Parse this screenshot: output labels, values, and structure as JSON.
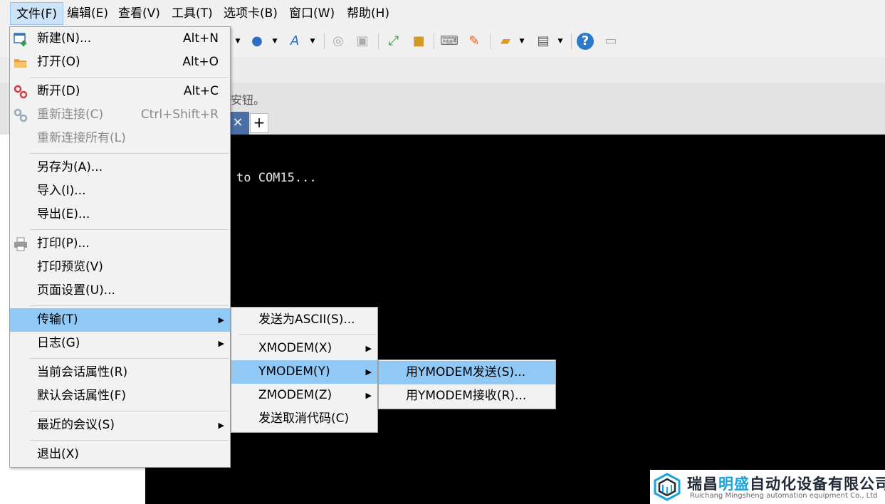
{
  "menubar": [
    "文件(F)",
    "编辑(E)",
    "查看(V)",
    "工具(T)",
    "选项卡(B)",
    "窗口(W)",
    "帮助(H)"
  ],
  "hint_text": "安钮。",
  "tab": {
    "close": "×",
    "new": "+"
  },
  "terminal": {
    "line": "to COM15..."
  },
  "file_menu": [
    {
      "label": "新建(N)...",
      "accel": "Alt+N"
    },
    {
      "label": "打开(O)",
      "accel": "Alt+O"
    },
    {
      "label": "断开(D)",
      "accel": "Alt+C"
    },
    {
      "label": "重新连接(C)",
      "accel": "Ctrl+Shift+R"
    },
    {
      "label": "重新连接所有(L)"
    },
    {
      "label": "另存为(A)..."
    },
    {
      "label": "导入(I)..."
    },
    {
      "label": "导出(E)..."
    },
    {
      "label": "打印(P)..."
    },
    {
      "label": "打印预览(V)"
    },
    {
      "label": "页面设置(U)..."
    },
    {
      "label": "传输(T)"
    },
    {
      "label": "日志(G)"
    },
    {
      "label": "当前会话属性(R)"
    },
    {
      "label": "默认会话属性(F)"
    },
    {
      "label": "最近的会议(S)"
    },
    {
      "label": "退出(X)"
    }
  ],
  "transfer_menu": [
    {
      "label": "发送为ASCII(S)..."
    },
    {
      "label": "XMODEM(X)"
    },
    {
      "label": "YMODEM(Y)"
    },
    {
      "label": "ZMODEM(Z)"
    },
    {
      "label": "发送取消代码(C)"
    }
  ],
  "ymodem_menu": [
    {
      "label": "用YMODEM发送(S)..."
    },
    {
      "label": "用YMODEM接收(R)..."
    }
  ],
  "logo": {
    "cn_a": "瑞昌",
    "cn_b": "明盛",
    "cn_c": "自动化设备有限公司",
    "en": "Ruichang Mingsheng automation equipment Co., Ltd"
  },
  "colors": {
    "highlight": "#90c8f6",
    "menu_bg": "#f2f2f2",
    "terminal_bg": "#000000",
    "logo_accent": "#1aa3d8"
  }
}
